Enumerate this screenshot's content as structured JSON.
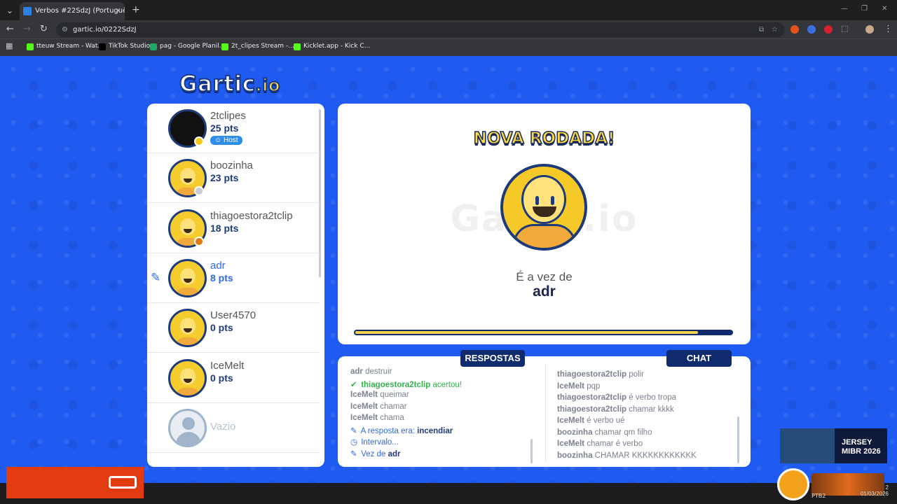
{
  "browser": {
    "tab_title": "Verbos #22SdzJ (Português) - G",
    "url": "gartic.io/0222SdzJ",
    "bookmarks": [
      {
        "label": "tteuw Stream - Wat...",
        "color": "#53fc18"
      },
      {
        "label": "TikTok Studio",
        "color": "#000000"
      },
      {
        "label": "pag - Google Planil...",
        "color": "#23a566"
      },
      {
        "label": "2t_clipes Stream -...",
        "color": "#53fc18"
      },
      {
        "label": "Kicklet.app - Kick C...",
        "color": "#53fc18"
      }
    ]
  },
  "logo": {
    "text": "Gartic",
    "suffix": ".io"
  },
  "players": [
    {
      "name": "2tclipes",
      "pts": "25 pts",
      "host": "Host",
      "status": "#f5c91c",
      "avatar": "dark"
    },
    {
      "name": "boozinha",
      "pts": "23 pts",
      "status": "#c9ccd3",
      "avatar": "default"
    },
    {
      "name": "thiagoestora2tclip",
      "pts": "18 pts",
      "status": "#e07b12",
      "avatar": "default"
    },
    {
      "name": "adr",
      "pts": "8 pts",
      "drawing": true,
      "avatar": "default"
    },
    {
      "name": "User4570",
      "pts": "0 pts",
      "avatar": "default"
    },
    {
      "name": "IceMelt",
      "pts": "0 pts",
      "avatar": "default"
    },
    {
      "name": "Vazio",
      "pts": "",
      "avatar": "empty"
    }
  ],
  "stage": {
    "heading": "NOVA RODADA!",
    "watermark": "Gartic.io",
    "turn_label": "É a vez de",
    "turn_name": "adr",
    "timer_progress": 0.91
  },
  "tabs": {
    "answers": "RESPOSTAS",
    "chat": "CHAT"
  },
  "answers": [
    {
      "user": "adr",
      "text": "destruir",
      "type": "plain"
    },
    {
      "user": "thiagoestora2tclip",
      "text": "acertou!",
      "type": "ok",
      "icon": "check-icon"
    },
    {
      "user": "IceMelt",
      "text": "queimar",
      "type": "plain"
    },
    {
      "user": "IceMelt",
      "text": "chamar",
      "type": "plain"
    },
    {
      "user": "IceMelt",
      "text": "chama",
      "type": "plain"
    },
    {
      "user": "",
      "text": "A resposta era:",
      "bold": "incendiar",
      "type": "info",
      "icon": "pencil-icon"
    },
    {
      "user": "",
      "text": "Intervalo...",
      "type": "info",
      "icon": "clock-icon"
    },
    {
      "user": "",
      "text": "Vez de",
      "bold": "adr",
      "type": "info",
      "icon": "pencil-icon"
    }
  ],
  "chat": [
    {
      "user": "thiagoestora2tclip",
      "text": "polir"
    },
    {
      "user": "IceMelt",
      "text": "pqp"
    },
    {
      "user": "thiagoestora2tclip",
      "text": "é verbo tropa"
    },
    {
      "user": "thiagoestora2tclip",
      "text": "chamar kkkk"
    },
    {
      "user": "IceMelt",
      "text": "é verbo ué"
    },
    {
      "user": "boozinha",
      "text": "chamar qm filho"
    },
    {
      "user": "IceMelt",
      "text": "chamar é verbo"
    },
    {
      "user": "boozinha",
      "text": "CHAMAR KKKKKKKKKKKK"
    }
  ],
  "overlay": {
    "jersey_line1": "JERSEY",
    "jersey_line2": "MIBR 2026"
  },
  "tray": {
    "lang": "PTB2",
    "date": "01/03/2026",
    "time": "2"
  }
}
